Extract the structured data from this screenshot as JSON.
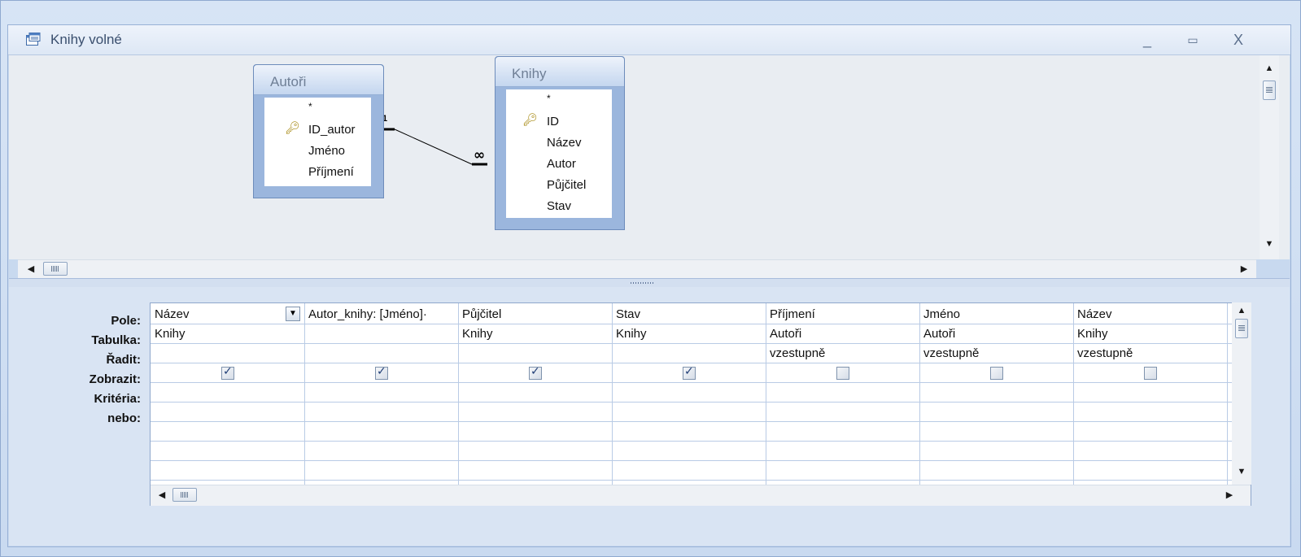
{
  "window": {
    "title": "Knihy volné",
    "minimize": "_",
    "maximize": "▭",
    "close": "X"
  },
  "tables": [
    {
      "name": "Autoři",
      "fields": [
        "*",
        "ID_autor",
        "Jméno",
        "Příjmení"
      ],
      "key_field": "ID_autor"
    },
    {
      "name": "Knihy",
      "fields": [
        "*",
        "ID",
        "Název",
        "Autor",
        "Půjčitel",
        "Stav"
      ],
      "key_field": "ID"
    }
  ],
  "relationship": {
    "one_label": "1",
    "many_label": "∞"
  },
  "grid": {
    "row_labels": [
      "Pole:",
      "Tabulka:",
      "Řadit:",
      "Zobrazit:",
      "Kritéria:",
      "nebo:"
    ],
    "columns": [
      {
        "field": "Název",
        "table": "Knihy",
        "sort": "",
        "show": true
      },
      {
        "field": "Autor_knihy: [Jméno]·",
        "table": "",
        "sort": "",
        "show": true
      },
      {
        "field": "Půjčitel",
        "table": "Knihy",
        "sort": "",
        "show": true
      },
      {
        "field": "Stav",
        "table": "Knihy",
        "sort": "",
        "show": true
      },
      {
        "field": "Příjmení",
        "table": "Autoři",
        "sort": "vzestupně",
        "show": false
      },
      {
        "field": "Jméno",
        "table": "Autoři",
        "sort": "vzestupně",
        "show": false
      },
      {
        "field": "Název",
        "table": "Knihy",
        "sort": "vzestupně",
        "show": false
      }
    ]
  },
  "icons": {
    "window": "query-icon",
    "key": "primary-key-icon",
    "up": "▲",
    "down": "▼",
    "left": "◀",
    "right": "▶",
    "dropdown": "▼"
  }
}
